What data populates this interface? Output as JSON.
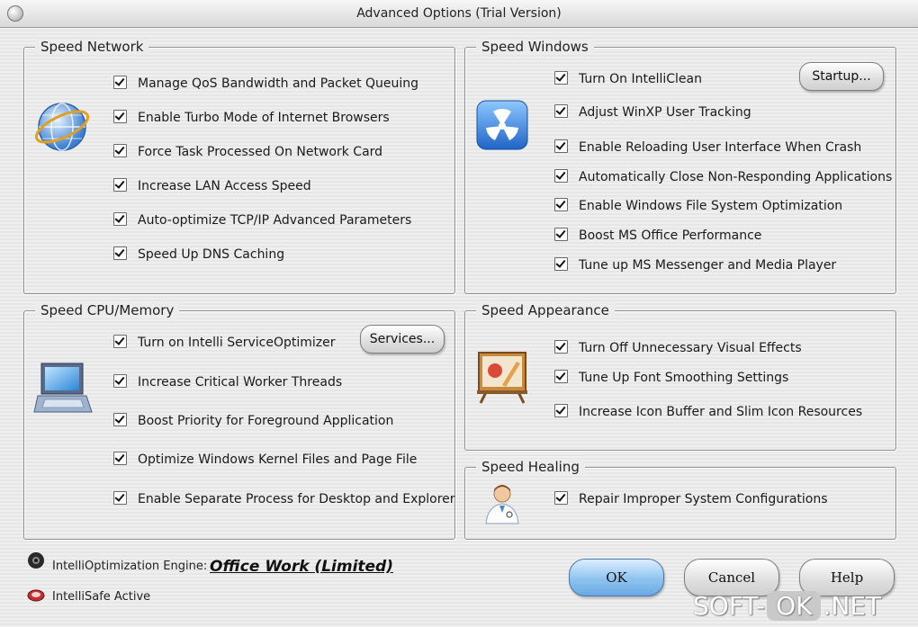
{
  "window": {
    "title": "Advanced Options (Trial Version)"
  },
  "speed_network": {
    "title": "Speed Network",
    "options": [
      "Manage QoS Bandwidth and Packet Queuing",
      "Enable Turbo Mode of Internet Browsers",
      "Force Task Processed On Network Card",
      "Increase LAN Access Speed",
      "Auto-optimize TCP/IP Advanced Parameters",
      "Speed Up DNS Caching"
    ]
  },
  "speed_windows": {
    "title": "Speed Windows",
    "button": "Startup...",
    "options": [
      "Turn On IntelliClean",
      "Adjust WinXP User Tracking",
      "Enable Reloading User Interface When Crash",
      "Automatically Close Non-Responding Applications",
      "Enable Windows File System Optimization",
      "Boost MS Office Performance",
      "Tune up MS Messenger and Media Player"
    ]
  },
  "speed_cpu": {
    "title": "Speed CPU/Memory",
    "button": "Services...",
    "options": [
      "Turn on Intelli ServiceOptimizer",
      "Increase Critical Worker Threads",
      "Boost Priority for Foreground Application",
      "Optimize Windows Kernel Files and Page File",
      "Enable Separate Process for Desktop and Explorer"
    ]
  },
  "speed_appearance": {
    "title": "Speed Appearance",
    "options": [
      "Turn Off Unnecessary Visual Effects",
      "Tune Up Font Smoothing Settings",
      "Increase Icon Buffer and Slim Icon Resources"
    ]
  },
  "speed_healing": {
    "title": "Speed Healing",
    "options": [
      "Repair Improper System Configurations"
    ]
  },
  "footer": {
    "engine_label": "IntelliOptimization Engine:",
    "engine_value": "Office Work (Limited)",
    "intellisafe": "IntelliSafe Active",
    "ok": "OK",
    "cancel": "Cancel",
    "help": "Help"
  },
  "watermark": {
    "part1": "SOFT-",
    "part2": "OK",
    "part3": ".NET"
  },
  "icons": [
    "globe-icon",
    "radiation-icon",
    "laptop-icon",
    "easel-icon",
    "doctor-icon",
    "engine-icon",
    "shield-icon"
  ]
}
